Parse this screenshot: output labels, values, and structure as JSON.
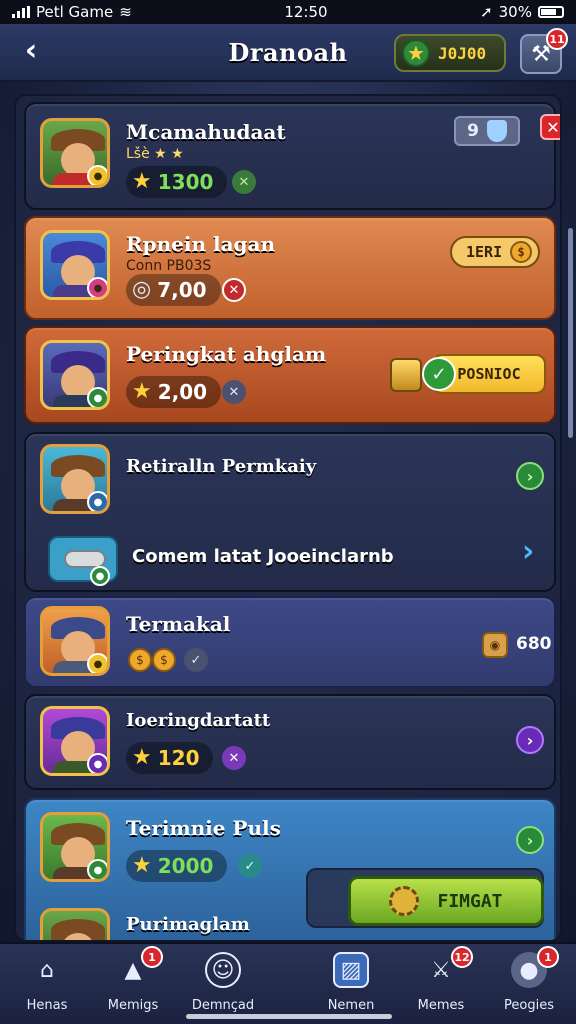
{
  "status_bar": {
    "carrier": "Petl Game",
    "time": "12:50",
    "battery": "30%"
  },
  "header": {
    "title": "Dranoah",
    "coins": "J0J00",
    "tools_badge": "11"
  },
  "cards": [
    {
      "name": "Mcamahudaat",
      "sub": "Lšè ★ ★",
      "value": "1300",
      "count": "9",
      "theme": "dark"
    },
    {
      "name": "Rpnein lagan",
      "sub": "Conn PB03S",
      "value": "7,00",
      "reward": "1ERI",
      "theme": "orange"
    },
    {
      "name": "Peringkat ahglam",
      "value": "2,00",
      "action": "POSNIOC",
      "theme": "orange2"
    },
    {
      "name": "Retiralln Permkaiy",
      "theme": "dark"
    },
    {
      "name": "Comem latat Jooeinclarnb",
      "theme": "dark"
    },
    {
      "name": "Termakal",
      "reward_value": "680",
      "theme": "purple"
    },
    {
      "name": "Ioeringdartatt",
      "value": "120",
      "theme": "dark"
    },
    {
      "name": "Terimnie Puls",
      "value": "2000",
      "theme": "blue"
    },
    {
      "name": "Purimaglam",
      "theme": "blue"
    }
  ],
  "claim_button": "FIMGAT",
  "tabs": [
    {
      "label": "Henas",
      "icon": "home-icon"
    },
    {
      "label": "Memigs",
      "icon": "bag-icon",
      "badge": "1"
    },
    {
      "label": "Demnçad",
      "icon": "profile-icon"
    },
    {
      "label": "Nemen",
      "icon": "map-icon"
    },
    {
      "label": "Memes",
      "icon": "swords-icon",
      "badge": "12"
    },
    {
      "label": "Peogies",
      "icon": "chat-icon",
      "badge": "1"
    }
  ],
  "colors": {
    "accent_gold": "#ffd23c",
    "accent_green": "#7ee05a",
    "card_orange": "#e08a52",
    "card_blue": "#3e86c6"
  }
}
